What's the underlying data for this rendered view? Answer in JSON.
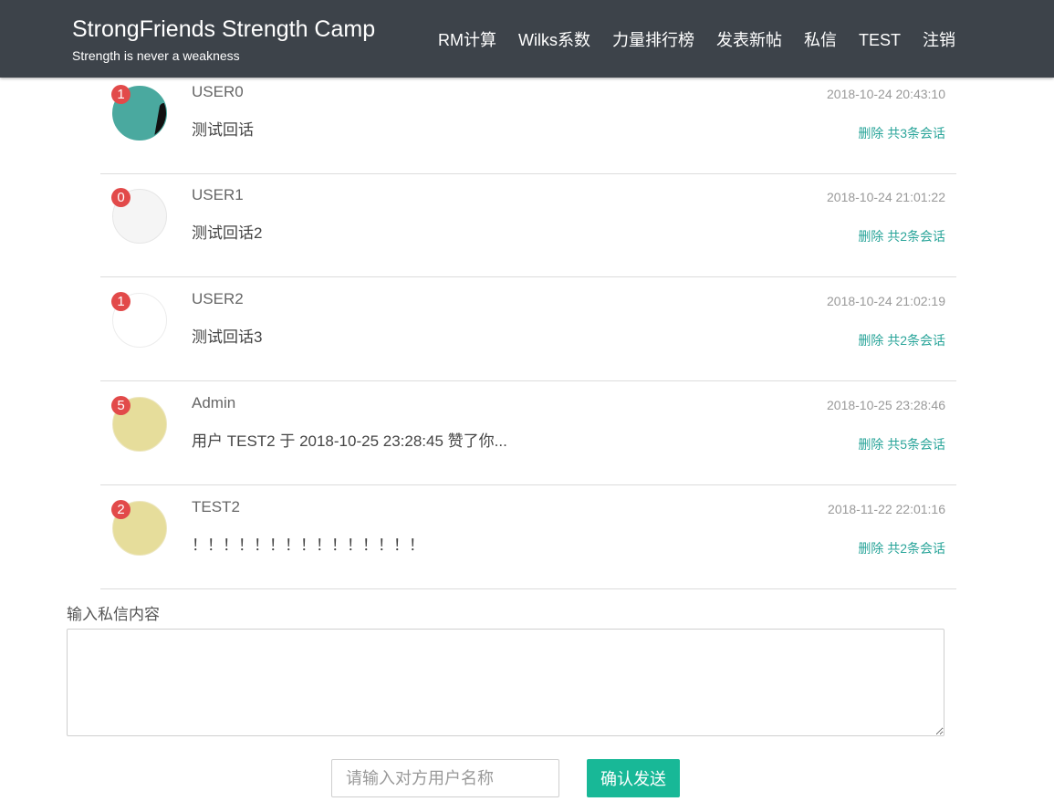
{
  "header": {
    "title": "StrongFriends Strength Camp",
    "subtitle": "Strength is never a weakness",
    "nav": [
      {
        "label": "RM计算"
      },
      {
        "label": "Wilks系数"
      },
      {
        "label": "力量排行榜"
      },
      {
        "label": "发表新帖"
      },
      {
        "label": "私信"
      },
      {
        "label": "TEST"
      },
      {
        "label": "注销"
      }
    ]
  },
  "conversations": [
    {
      "user": "USER0",
      "preview": "测试回话",
      "time": "2018-10-24 20:43:10",
      "unread": "1",
      "delete_label": "删除",
      "count_label": "共3条会话",
      "avatar_color": "#4aa99f",
      "avatar_border": "#4aa99f"
    },
    {
      "user": "USER1",
      "preview": "测试回话2",
      "time": "2018-10-24 21:01:22",
      "unread": "0",
      "delete_label": "删除",
      "count_label": "共2条会话",
      "avatar_color": "#f5f5f5",
      "avatar_border": "#e6e6e6"
    },
    {
      "user": "USER2",
      "preview": "测试回话3",
      "time": "2018-10-24 21:02:19",
      "unread": "1",
      "delete_label": "删除",
      "count_label": "共2条会话",
      "avatar_color": "#ffffff",
      "avatar_border": "#ececec"
    },
    {
      "user": "Admin",
      "preview": "用户 TEST2 于 2018-10-25 23:28:45 赞了你...",
      "time": "2018-10-25 23:28:46",
      "unread": "5",
      "delete_label": "删除",
      "count_label": "共5条会话",
      "avatar_color": "#e6dd9b",
      "avatar_border": "#ece6bf"
    },
    {
      "user": "TEST2",
      "preview": "！！！！！！！！！！！！！！！",
      "time": "2018-11-22 22:01:16",
      "unread": "2",
      "delete_label": "删除",
      "count_label": "共2条会话",
      "avatar_color": "#e6dd9b",
      "avatar_border": "#ece6bf"
    }
  ],
  "compose": {
    "label": "输入私信内容",
    "message_value": "",
    "recipient_placeholder": "请输入对方用户名称",
    "recipient_value": "",
    "send_label": "确认发送"
  },
  "colors": {
    "navbar": "#3d434a",
    "badge": "#e24a4a",
    "link": "#2aa59a",
    "button": "#18b897"
  }
}
